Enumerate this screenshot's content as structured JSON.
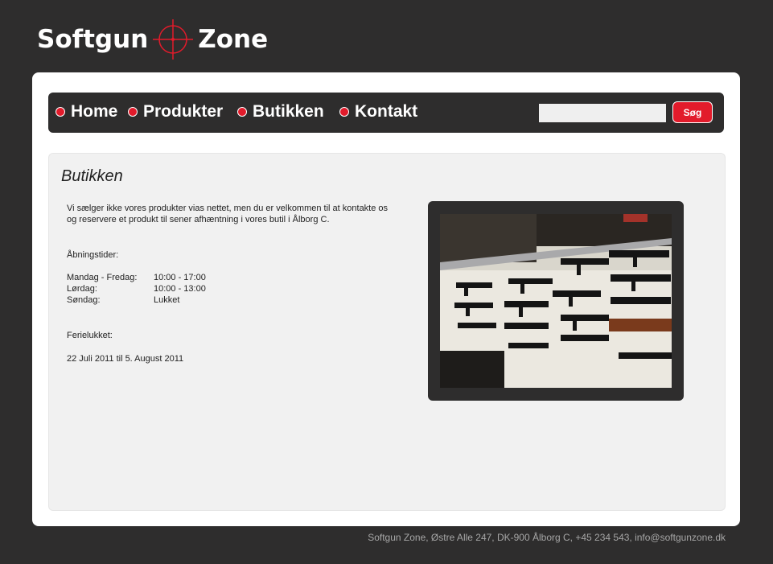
{
  "logo": {
    "left": "Softgun",
    "right": "Zone"
  },
  "nav": {
    "items": [
      {
        "label": "Home"
      },
      {
        "label": "Produkter"
      },
      {
        "label": "Butikken"
      },
      {
        "label": "Kontakt"
      }
    ],
    "search_button": "Søg",
    "search_value": ""
  },
  "page": {
    "title": "Butikken",
    "intro_line1": "Vi sælger ikke vores produkter vias nettet, men du er velkommen til at kontakte os",
    "intro_line2": "og reservere et produkt til sener afhæntning i vores butil i Ålborg C.",
    "hours_title": "Åbningstider:",
    "hours": [
      {
        "day": "Mandag - Fredag:",
        "time": "10:00 - 17:00"
      },
      {
        "day": "Lørdag:",
        "time": "10:00 - 13:00"
      },
      {
        "day": "Søndag:",
        "time": "Lukket"
      }
    ],
    "holiday_title": "Ferielukket:",
    "holiday_dates": "22 Juli 2011  til 5.  August 2011"
  },
  "footer": {
    "text": "Softgun Zone, Østre Alle 247, DK-900 Ålborg C, +45 234 543, info@softgunzone.dk"
  },
  "colors": {
    "background": "#2e2d2d",
    "accent": "#e21b2b",
    "panel": "#f1f1f1"
  }
}
